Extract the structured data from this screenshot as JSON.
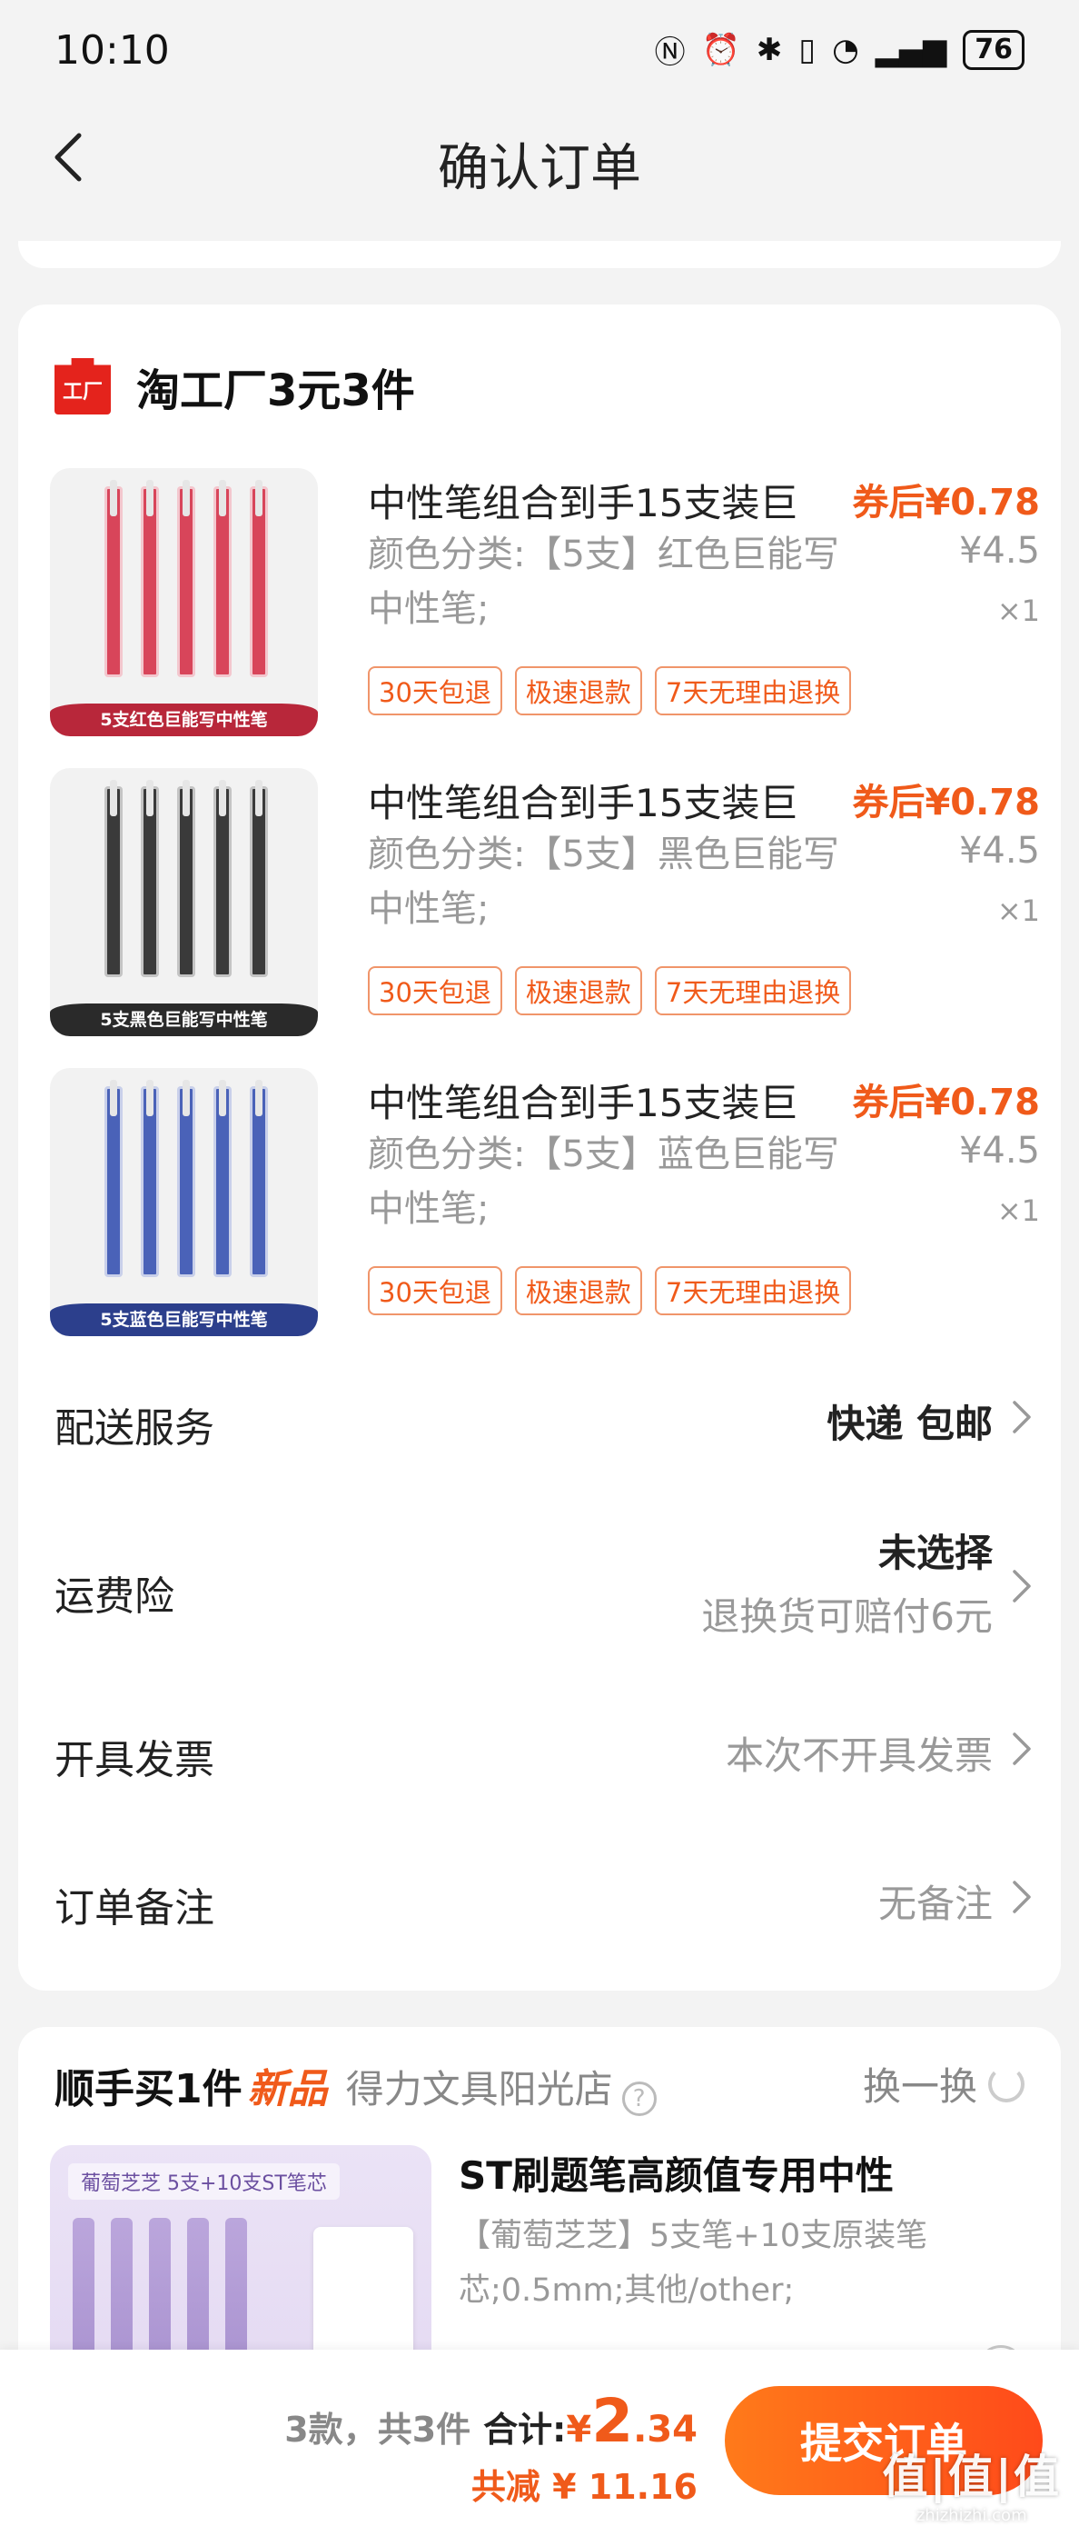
{
  "status_bar": {
    "time": "10:10",
    "battery": "76"
  },
  "header": {
    "title": "确认订单"
  },
  "shop": {
    "logo_text": "工厂",
    "name": "淘工厂3元3件"
  },
  "products": [
    {
      "title": "中性笔组合到手15支装巨",
      "coupon_price": "券后¥0.78",
      "variant": "颜色分类:【5支】红色巨能写中性笔;",
      "price": "¥4.5",
      "qty": "×1",
      "tags": [
        "30天包退",
        "极速退款",
        "7天无理由退换"
      ],
      "thumb_label": "5支红色巨能写中性笔",
      "pen_color": "#d8455a",
      "label_color": "#b8273a"
    },
    {
      "title": "中性笔组合到手15支装巨",
      "coupon_price": "券后¥0.78",
      "variant": "颜色分类:【5支】黑色巨能写中性笔;",
      "price": "¥4.5",
      "qty": "×1",
      "tags": [
        "30天包退",
        "极速退款",
        "7天无理由退换"
      ],
      "thumb_label": "5支黑色巨能写中性笔",
      "pen_color": "#3a3a3a",
      "label_color": "#2a2a2a"
    },
    {
      "title": "中性笔组合到手15支装巨",
      "coupon_price": "券后¥0.78",
      "variant": "颜色分类:【5支】蓝色巨能写中性笔;",
      "price": "¥4.5",
      "qty": "×1",
      "tags": [
        "30天包退",
        "极速退款",
        "7天无理由退换"
      ],
      "thumb_label": "5支蓝色巨能写中性笔",
      "pen_color": "#4a62b8",
      "label_color": "#2c3f8c"
    }
  ],
  "delivery": {
    "label": "配送服务",
    "value": "快递 包邮"
  },
  "insurance": {
    "label": "运费险",
    "value": "未选择",
    "sub": "退换货可赔付6元"
  },
  "invoice": {
    "label": "开具发票",
    "value": "本次不开具发票"
  },
  "remark": {
    "label": "订单备注",
    "value": "无备注"
  },
  "recommend": {
    "title": "顺手买1件",
    "badge": "新品",
    "store": "得力文具阳光店",
    "help_icon": "?",
    "swap_label": "换一换",
    "pack_label": "葡萄芝芝 5支+10支ST笔芯",
    "product_title": "ST刷题笔高颜值专用中性",
    "product_desc": "【葡萄芝芝】5支笔+10支原装笔芯;0.5mm;其他/other;"
  },
  "summary": {
    "count": "3款，共3件",
    "total_label": "合计:",
    "currency": "¥",
    "total_int": "2",
    "total_dec": ".34",
    "saved": "共减 ¥ 11.16",
    "submit": "提交订单"
  },
  "watermark": {
    "big": "值|值|值",
    "small": "zhizhizhi.com"
  },
  "colors": {
    "accent": "#f05a1a",
    "page_bg": "#f3f3f3",
    "tag_border": "#f0956a"
  }
}
